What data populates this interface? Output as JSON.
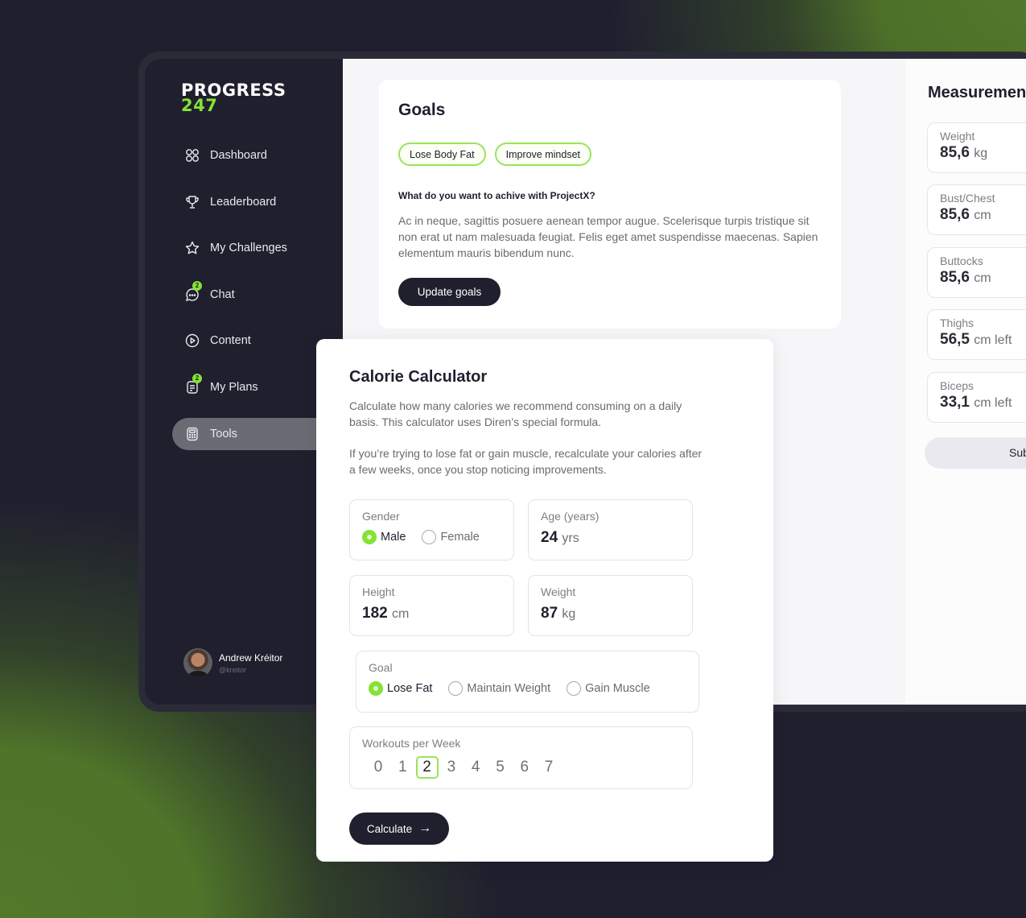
{
  "brand": {
    "line1": "PROGRESS",
    "line2": "247",
    "accent_color": "#86e234",
    "dark_color": "#1f1f2e"
  },
  "sidebar": {
    "items": [
      {
        "label": "Dashboard",
        "icon": "grid-icon",
        "badge": null,
        "active": false
      },
      {
        "label": "Leaderboard",
        "icon": "trophy-icon",
        "badge": null,
        "active": false
      },
      {
        "label": "My Challenges",
        "icon": "star-icon",
        "badge": null,
        "active": false
      },
      {
        "label": "Chat",
        "icon": "chat-icon",
        "badge": "2",
        "active": false
      },
      {
        "label": "Content",
        "icon": "play-circle-icon",
        "badge": null,
        "active": false
      },
      {
        "label": "My Plans",
        "icon": "document-icon",
        "badge": "2",
        "active": false
      },
      {
        "label": "Tools",
        "icon": "calculator-icon",
        "badge": null,
        "active": true
      }
    ],
    "user": {
      "name": "Andrew Kréitor",
      "handle": "@kreitor"
    }
  },
  "goals": {
    "title": "Goals",
    "chips": [
      "Lose Body Fat",
      "Improve mindset"
    ],
    "question": "What do you want to achive with ProjectX?",
    "text": "Ac in neque, sagittis posuere aenean tempor augue. Scelerisque turpis tristique sit non erat ut nam malesuada feugiat. Felis eget amet suspendisse maecenas. Sapien elementum mauris bibendum nunc.",
    "button": "Update goals"
  },
  "measurements": {
    "title": "Measurements",
    "items": [
      {
        "label": "Weight",
        "value": "85,6",
        "unit": "kg"
      },
      {
        "label": "Bust/Chest",
        "value": "85,6",
        "unit": "cm"
      },
      {
        "label": "Buttocks",
        "value": "85,6",
        "unit": "cm"
      },
      {
        "label": "Thighs",
        "value": "56,5",
        "unit": "cm left"
      },
      {
        "label": "Biceps",
        "value": "33,1",
        "unit": "cm left"
      }
    ],
    "submit": "Sub"
  },
  "calculator": {
    "title": "Calorie Calculator",
    "desc1": "Calculate how many calories we recommend consuming on a daily basis. This calculator uses Diren’s special formula.",
    "desc2": "If you’re trying to lose fat or gain muscle, recalculate your calories after a few weeks, once you stop noticing improvements.",
    "gender": {
      "label": "Gender",
      "options": [
        "Male",
        "Female"
      ],
      "selected": "Male"
    },
    "age": {
      "label": "Age (years)",
      "value": "24",
      "unit": "yrs"
    },
    "height": {
      "label": "Height",
      "value": "182",
      "unit": "cm"
    },
    "weight": {
      "label": "Weight",
      "value": "87",
      "unit": "kg"
    },
    "goal": {
      "label": "Goal",
      "options": [
        "Lose Fat",
        "Maintain Weight",
        "Gain Muscle"
      ],
      "selected": "Lose Fat"
    },
    "workouts": {
      "label": "Workouts per Week",
      "options": [
        "0",
        "1",
        "2",
        "3",
        "4",
        "5",
        "6",
        "7"
      ],
      "selected": "2"
    },
    "button": "Calculate"
  }
}
